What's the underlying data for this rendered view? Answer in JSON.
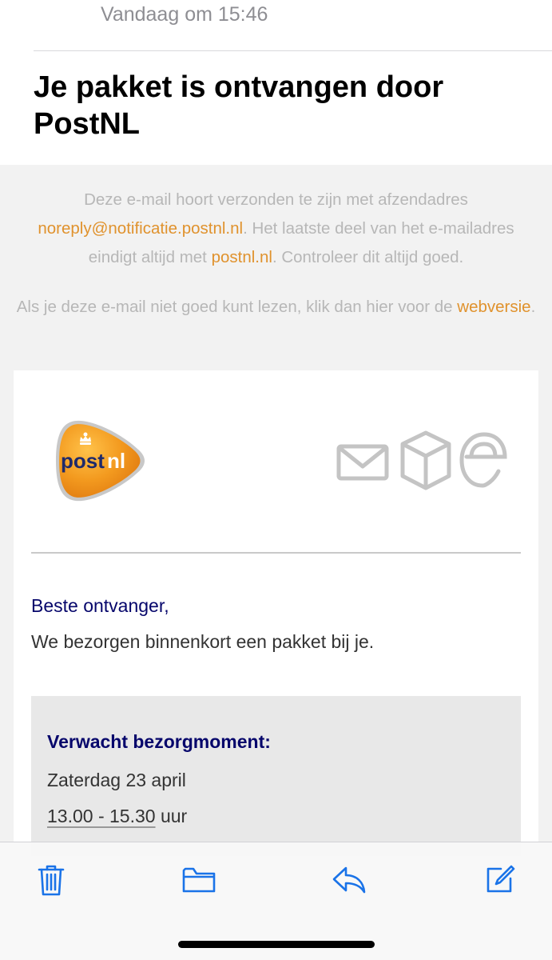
{
  "header": {
    "received": "Vandaag om 15:46",
    "subject": "Je pakket is ontvangen door PostNL"
  },
  "notice": {
    "sender_pre": "Deze e-mail hoort verzonden te zijn met afzendadres ",
    "sender_email": "noreply@notificatie.postnl.nl",
    "sender_mid": ". Het laatste deel van het e-mailadres eindigt altijd met ",
    "sender_domain": "postnl.nl",
    "sender_post": ". Controleer dit altijd goed.",
    "web_pre": "Als je deze e-mail niet goed kunt lezen, klik dan hier voor de ",
    "web_link": "webversie",
    "web_post": "."
  },
  "logo": {
    "text_post": "post",
    "text_nl": "nl"
  },
  "service_icons": [
    "envelope-icon",
    "package-icon",
    "at-sign-icon"
  ],
  "body": {
    "greeting": "Beste ontvanger,",
    "intro": "We bezorgen binnenkort een pakket bij je."
  },
  "delivery": {
    "title": "Verwacht bezorgmoment:",
    "date": "Zaterdag 23 april",
    "time_range": "13.00 - 15.30",
    "time_unit": " uur"
  },
  "toolbar": {
    "icons": [
      "trash-icon",
      "folder-icon",
      "reply-icon",
      "compose-icon"
    ]
  },
  "colors": {
    "accent_link": "#e0922d",
    "postnl_navy": "#06066b",
    "ios_blue": "#1a73e8",
    "postnl_orange": "#f39a1f"
  }
}
